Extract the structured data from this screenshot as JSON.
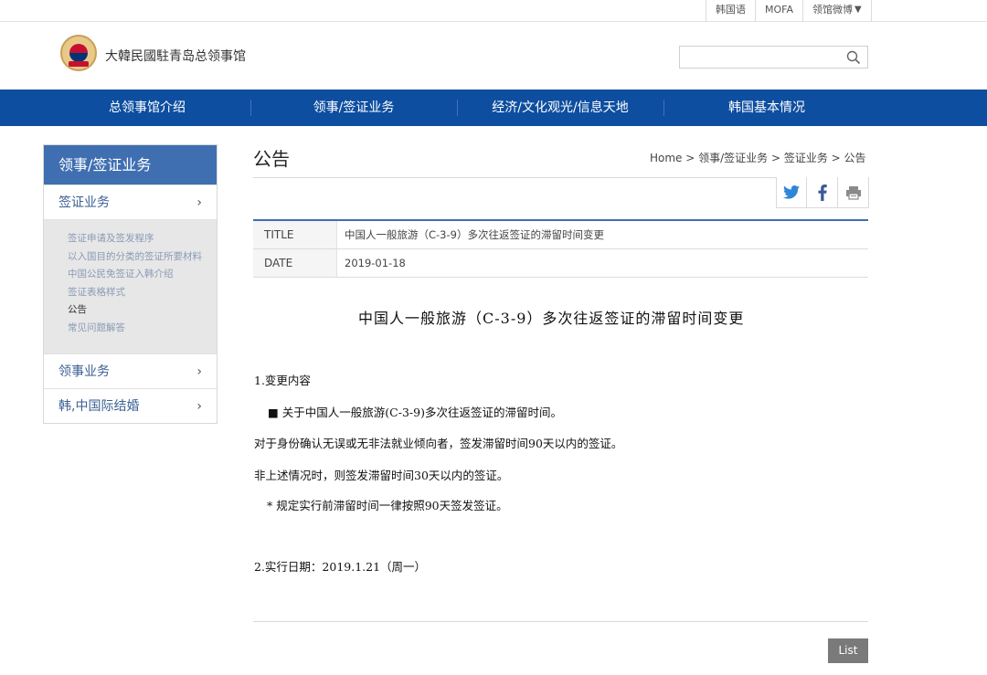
{
  "utility": {
    "links": [
      "韩国语",
      "MOFA",
      "领馆微博"
    ]
  },
  "header": {
    "site_title": "大韓民國駐青岛总领事馆",
    "search_placeholder": ""
  },
  "nav": {
    "items": [
      "总领事馆介绍",
      "领事/签证业务",
      "经济/文化观光/信息天地",
      "韩国基本情况"
    ]
  },
  "sidebar": {
    "heading": "领事/签证业务",
    "visa_label": "签证业务",
    "sub_items": [
      "签证申请及签发程序",
      "以入国目的分类的签证所要材料",
      "中国公民免签证入韩介绍",
      "签证表格样式",
      "公告",
      "常见问题解答"
    ],
    "consular_label": "领事业务",
    "marriage_label": "韩,中国际结婚"
  },
  "content": {
    "page_title": "公告",
    "breadcrumb": "Home > 领事/签证业务 > 签证业务 > 公告",
    "title_key": "TITLE",
    "title_value": "中国人一般旅游（C-3-9）多次往返签证的滞留时间变更",
    "date_key": "DATE",
    "date_value": "2019-01-18"
  },
  "article": {
    "heading": "中国人一般旅游（C-3-9）多次往返签证的滞留时间变更",
    "line1": "1.变更内容",
    "line2": "■ 关于中国人一般旅游(C-3-9)多次往返签证的滞留时间。",
    "line3": "对于身份确认无误或无非法就业倾向者，签发滞留时间90天以内的签证。",
    "line4": "非上述情况时，则签发滞留时间30天以内的签证。",
    "line5": "* 规定实行前滞留时间一律按照90天签发签证。",
    "line6": "2.实行日期：2019.1.21（周一）"
  },
  "footer": {
    "list_label": "List"
  },
  "colors": {
    "nav_blue": "#0d4ea0",
    "sidebar_blue": "#3f6fb1"
  }
}
